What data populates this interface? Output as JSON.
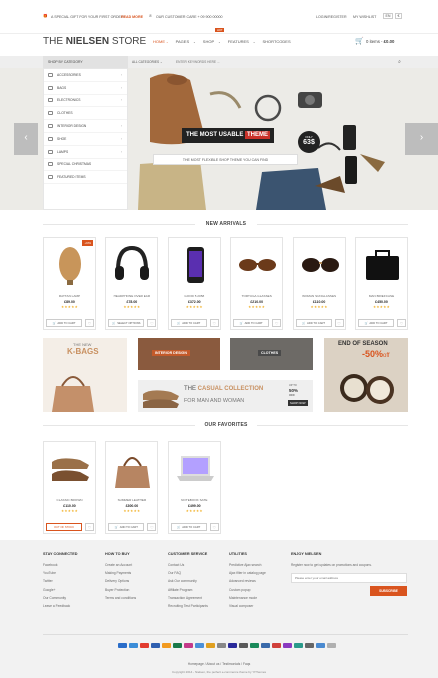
{
  "topbar": {
    "promo": "A SPECIAL GIFT FOR YOUR FIRST ORDER!",
    "read_more": "READ MORE",
    "care": "OUR CUSTOMER CARE + 09 900 00000",
    "login": "LOGIN/REGISTER",
    "wishlist": "MY WISHLIST",
    "lang_en": "EN",
    "lang_eur": "€"
  },
  "header": {
    "logo_prefix": "THE ",
    "logo_bold": "NIELSEN",
    "logo_suffix": " STORE",
    "nav": [
      "HOME",
      "PAGES",
      "SHOP",
      "FEATURES",
      "SHORTCODES"
    ],
    "shop_badge": "HOT",
    "cart": "0 items - ",
    "cart_total": "£0.00"
  },
  "catbar": {
    "shop_by": "SHOP BY CATEGORY",
    "all_categories": "ALL CATEGORIES",
    "search_placeholder": "ENTER KEYWORDS HERE ..."
  },
  "sidebar": [
    {
      "label": "ACCESSORIES",
      "icon": "watch-icon",
      "arrow": true
    },
    {
      "label": "BAGS",
      "icon": "bag-icon",
      "arrow": true
    },
    {
      "label": "ELECTRONICS",
      "icon": "tv-icon",
      "arrow": true
    },
    {
      "label": "CLOTHES",
      "icon": "shirt-icon",
      "arrow": false
    },
    {
      "label": "INTERIOR DESIGN",
      "icon": "sofa-icon",
      "arrow": true
    },
    {
      "label": "SHOE",
      "icon": "shoe-icon",
      "arrow": true
    },
    {
      "label": "LAMPS",
      "icon": "lamp-icon",
      "arrow": true
    },
    {
      "label": "SPECIAL CHRISTMAS",
      "icon": "gift-icon",
      "arrow": false
    },
    {
      "label": "FEATURED ITEMS",
      "icon": "star-icon",
      "arrow": false
    }
  ],
  "hero": {
    "headline_a": "THE MOST USABLE ",
    "headline_b": "THEME",
    "only": "ONLY",
    "price": "63$",
    "subline": "THE MOST FLEXIBLE SHOP THEME YOU CAN FIND"
  },
  "new_arrivals": {
    "title": "NEW ARRIVALS",
    "products": [
      {
        "name": "RATTAN LAMP",
        "price": "£89.00",
        "button": "ADD TO CART",
        "sale": "-23%"
      },
      {
        "name": "HEADPHONE OVER EAR",
        "price": "£78.00",
        "button": "SELECT OPTIONS",
        "sale": ""
      },
      {
        "name": "GOOD 5 2058",
        "price": "£372.00",
        "button": "ADD TO CART",
        "sale": ""
      },
      {
        "name": "TORTUGA GLASSES",
        "price": "£210.00",
        "button": "ADD TO CART",
        "sale": ""
      },
      {
        "name": "WOMAN SUNGLASSES",
        "price": "£110.00",
        "button": "ADD TO CART",
        "sale": ""
      },
      {
        "name": "MAN BRIEFCASE",
        "price": "£450.00",
        "button": "ADD TO CART",
        "sale": ""
      }
    ],
    "stars": "★★★★★"
  },
  "banners": {
    "kbags_a": "THE NEW",
    "kbags_b": "K-BAGS",
    "interior": "INTERIOR DESIGN",
    "clothes": "CLOTHES",
    "casual_a": "THE ",
    "casual_b": "CASUAL COLLECTION",
    "casual_c": "FOR MAN AND WOMAN",
    "upto": "UP TO",
    "off": "50%",
    "off_word": "OFF",
    "shop_now": "SHOP NOW",
    "season": "END OF SEASON",
    "season_off": "-50%",
    "season_off_word": "off"
  },
  "favorites": {
    "title": "OUR FAVORITES",
    "products": [
      {
        "name": "CLASSIC BROWN",
        "price": "£110.00",
        "button": "OUT OF STOCK"
      },
      {
        "name": "SUMMER LEATHER",
        "price": "£300.00",
        "button": "ADD TO CART"
      },
      {
        "name": "NOTEBOOK SATE",
        "price": "£499.00",
        "button": "ADD TO CART"
      }
    ]
  },
  "footer": {
    "stay": {
      "title": "STAY CONNECTED",
      "items": [
        "Facebook",
        "YouTube",
        "Twitter",
        "Google+",
        "Our Community",
        "Leave a Feedback"
      ]
    },
    "how": {
      "title": "HOW TO BUY",
      "items": [
        "Create an Account",
        "Making Payments",
        "Delivery Options",
        "Buyer Protection",
        "Terms and conditions"
      ]
    },
    "service": {
      "title": "CUSTOMER SERVICE",
      "items": [
        "Contact Us",
        "Our FAQ",
        "Ask Our community",
        "Affiliate Program",
        "Transaction Agreement",
        "Recruiting Test Participants"
      ]
    },
    "utilities": {
      "title": "UTILITIES",
      "items": [
        "Predictive Ajax search",
        "Ajax filter in catalog page",
        "Advanced reviews",
        "Custom popup",
        "Maintenance mode",
        "Visual composer"
      ]
    },
    "newsletter": {
      "title": "ENJOY NIELSEN",
      "text": "Register now to get updates on promotions and coupons.",
      "placeholder": "Please enter your email address",
      "button": "SUBSCRIBE"
    },
    "bottom_links": "Homepage / About us / Testimonials / Faqs",
    "copyright": "Copyright 2014 - Nielsen, the perfect e-commerce theme by YIThemes"
  },
  "colors": {
    "accent": "#d9541e",
    "star": "#f0ad1f",
    "footer_bg": "#f2f2f2"
  }
}
